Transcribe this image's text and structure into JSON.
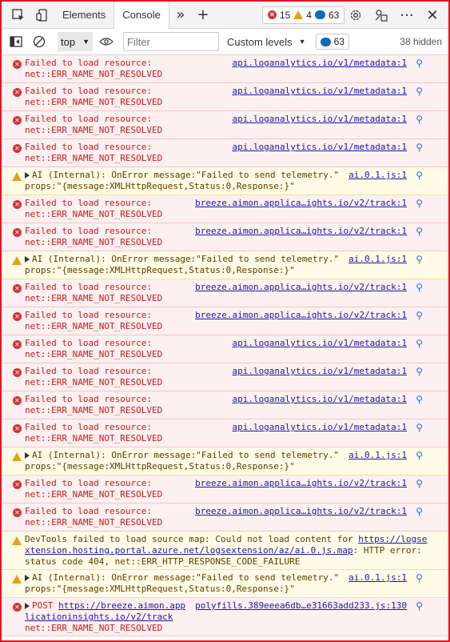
{
  "tabs": {
    "elements": "Elements",
    "console": "Console"
  },
  "counts": {
    "errors": "15",
    "warnings": "4",
    "info": "63"
  },
  "toolbar": {
    "context": "top",
    "filter_placeholder": "Filter",
    "levels": "Custom levels",
    "messages": "63",
    "hidden": "38 hidden"
  },
  "colors": {
    "error": "#d13438",
    "warning": "#e3a21a",
    "accent": "#0f6cbd",
    "frame": "#e81123"
  },
  "messages": [
    {
      "type": "error",
      "l1": "Failed to load resource:",
      "l2": "net::ERR_NAME_NOT_RESOLVED",
      "src": "api.loganalytics.io/v1/metadata:1"
    },
    {
      "type": "error",
      "l1": "Failed to load resource:",
      "l2": "net::ERR_NAME_NOT_RESOLVED",
      "src": "api.loganalytics.io/v1/metadata:1"
    },
    {
      "type": "error",
      "l1": "Failed to load resource:",
      "l2": "net::ERR_NAME_NOT_RESOLVED",
      "src": "api.loganalytics.io/v1/metadata:1"
    },
    {
      "type": "error",
      "l1": "Failed to load resource:",
      "l2": "net::ERR_NAME_NOT_RESOLVED",
      "src": "api.loganalytics.io/v1/metadata:1"
    },
    {
      "type": "warn",
      "l1": "AI (Internal): OnError message:\"Failed to send telemetry.\"",
      "l2": "props:\"{message:XMLHttpRequest,Status:0,Response:}\"",
      "src": "ai.0.1.js:1"
    },
    {
      "type": "error",
      "l1": "Failed to load resource:",
      "l2": "net::ERR_NAME_NOT_RESOLVED",
      "src": "breeze.aimon.applica…ights.io/v2/track:1"
    },
    {
      "type": "error",
      "l1": "Failed to load resource:",
      "l2": "net::ERR_NAME_NOT_RESOLVED",
      "src": "breeze.aimon.applica…ights.io/v2/track:1"
    },
    {
      "type": "warn",
      "l1": "AI (Internal): OnError message:\"Failed to send telemetry.\"",
      "l2": "props:\"{message:XMLHttpRequest,Status:0,Response:}\"",
      "src": "ai.0.1.js:1"
    },
    {
      "type": "error",
      "l1": "Failed to load resource:",
      "l2": "net::ERR_NAME_NOT_RESOLVED",
      "src": "breeze.aimon.applica…ights.io/v2/track:1"
    },
    {
      "type": "error",
      "l1": "Failed to load resource:",
      "l2": "net::ERR_NAME_NOT_RESOLVED",
      "src": "breeze.aimon.applica…ights.io/v2/track:1"
    },
    {
      "type": "error",
      "l1": "Failed to load resource:",
      "l2": "net::ERR_NAME_NOT_RESOLVED",
      "src": "api.loganalytics.io/v1/metadata:1"
    },
    {
      "type": "error",
      "l1": "Failed to load resource:",
      "l2": "net::ERR_NAME_NOT_RESOLVED",
      "src": "api.loganalytics.io/v1/metadata:1"
    },
    {
      "type": "error",
      "l1": "Failed to load resource:",
      "l2": "net::ERR_NAME_NOT_RESOLVED",
      "src": "api.loganalytics.io/v1/metadata:1"
    },
    {
      "type": "error",
      "l1": "Failed to load resource:",
      "l2": "net::ERR_NAME_NOT_RESOLVED",
      "src": "api.loganalytics.io/v1/metadata:1"
    },
    {
      "type": "warn",
      "l1": "AI (Internal): OnError message:\"Failed to send telemetry.\"",
      "l2": "props:\"{message:XMLHttpRequest,Status:0,Response:}\"",
      "src": "ai.0.1.js:1"
    },
    {
      "type": "error",
      "l1": "Failed to load resource:",
      "l2": "net::ERR_NAME_NOT_RESOLVED",
      "src": "breeze.aimon.applica…ights.io/v2/track:1"
    },
    {
      "type": "error",
      "l1": "Failed to load resource:",
      "l2": "net::ERR_NAME_NOT_RESOLVED",
      "src": "breeze.aimon.applica…ights.io/v2/track:1"
    }
  ],
  "sourcemap": {
    "l1": "DevTools failed to load source map: Could not load content for ",
    "link": "https://logse",
    "l2link": "xtension.hosting.portal.azure.net/logsextension/az/ai.0.js.map",
    "l2rest": ": HTTP error:",
    "l3": "status code 404, net::ERR_HTTP_RESPONSE_CODE_FAILURE"
  },
  "last_warn": {
    "l1": "AI (Internal): OnError message:\"Failed to send telemetry.\"",
    "l2": "props:\"{message:XMLHttpRequest,Status:0,Response:}\"",
    "src": "ai.0.1.js:1"
  },
  "post": {
    "verb": "POST",
    "url1": "https://breeze.aimon.app",
    "url2": "licationinsights.io/v2/track",
    "l3": "net::ERR_NAME_NOT_RESOLVED",
    "src": "polyfills.389eeea6db…e31663add233.js:130"
  }
}
